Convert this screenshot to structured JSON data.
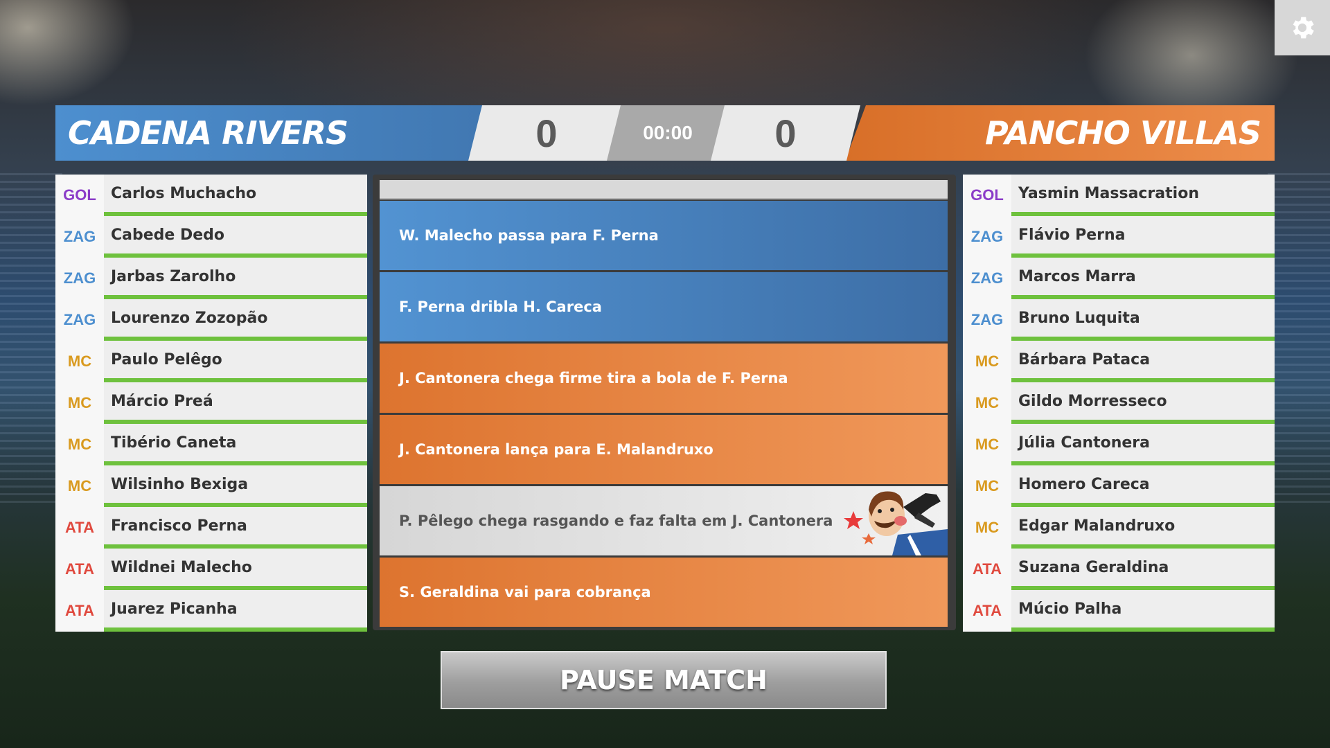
{
  "scoreboard": {
    "home_team": "CADENA RIVERS",
    "away_team": "PANCHO VILLAS",
    "home_score": "0",
    "away_score": "0",
    "clock": "00:00"
  },
  "home_roster": [
    {
      "pos": "GOL",
      "name": "Carlos Muchacho"
    },
    {
      "pos": "ZAG",
      "name": "Cabede Dedo"
    },
    {
      "pos": "ZAG",
      "name": "Jarbas Zarolho"
    },
    {
      "pos": "ZAG",
      "name": "Lourenzo Zozopão"
    },
    {
      "pos": "MC",
      "name": "Paulo Pelêgo"
    },
    {
      "pos": "MC",
      "name": "Márcio Preá"
    },
    {
      "pos": "MC",
      "name": "Tibério Caneta"
    },
    {
      "pos": "MC",
      "name": "Wilsinho Bexiga"
    },
    {
      "pos": "ATA",
      "name": "Francisco Perna"
    },
    {
      "pos": "ATA",
      "name": "Wildnei Malecho"
    },
    {
      "pos": "ATA",
      "name": "Juarez Picanha"
    }
  ],
  "away_roster": [
    {
      "pos": "GOL",
      "name": "Yasmin Massacration"
    },
    {
      "pos": "ZAG",
      "name": "Flávio Perna"
    },
    {
      "pos": "ZAG",
      "name": "Marcos Marra"
    },
    {
      "pos": "ZAG",
      "name": "Bruno Luquita"
    },
    {
      "pos": "MC",
      "name": "Bárbara Pataca"
    },
    {
      "pos": "MC",
      "name": "Gildo Morresseco"
    },
    {
      "pos": "MC",
      "name": "Júlia Cantonera"
    },
    {
      "pos": "MC",
      "name": "Homero Careca"
    },
    {
      "pos": "MC",
      "name": "Edgar Malandruxo"
    },
    {
      "pos": "ATA",
      "name": "Suzana Geraldina"
    },
    {
      "pos": "ATA",
      "name": "Múcio Palha"
    }
  ],
  "feed": [
    {
      "text": "W. Malecho passa para F. Perna",
      "team": "home"
    },
    {
      "text": "F. Perna dribla H. Careca",
      "team": "home"
    },
    {
      "text": "J. Cantonera chega firme tira a bola de F. Perna",
      "team": "away"
    },
    {
      "text": "J. Cantonera lança para E. Malandruxo",
      "team": "away"
    },
    {
      "text": "P. Pêlego chega rasgando e faz falta em J. Cantonera",
      "team": "foul"
    },
    {
      "text": "S. Geraldina vai para cobrança",
      "team": "away"
    }
  ],
  "buttons": {
    "pause_label": "PAUSE MATCH"
  },
  "icons": {
    "settings": "gear-icon",
    "foul_illustration": "foul-cartoon-icon"
  },
  "colors": {
    "home": "#4d8fcf",
    "away": "#e07b35",
    "gol": "#8b3cc8",
    "zag": "#4d8fcf",
    "mc": "#d99a1f",
    "ata": "#e04a3f",
    "stamina": "#6ec13d"
  }
}
